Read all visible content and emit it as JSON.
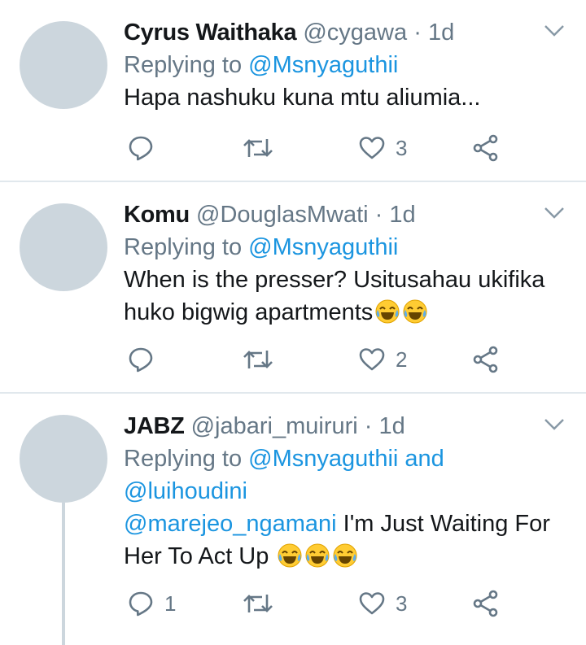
{
  "tweets": [
    {
      "name": "Cyrus Waithaka",
      "handle": "@cygawa",
      "dot": "·",
      "time": "1d",
      "replying_prefix": "Replying to",
      "replying_to": "@Msnyaguthii",
      "text": "Hapa nashuku kuna mtu aliumia...",
      "reply_count": "",
      "retweet_count": "",
      "like_count": "3"
    },
    {
      "name": "Komu",
      "handle": "@DouglasMwati",
      "dot": "·",
      "time": "1d",
      "replying_prefix": "Replying to",
      "replying_to": "@Msnyaguthii",
      "text_line1": "When is the presser? Usitusahau ukifika",
      "text_line2": "huko bigwig apartments",
      "reply_count": "",
      "retweet_count": "",
      "like_count": "2"
    },
    {
      "name": "JABZ",
      "handle": "@jabari_muiruri",
      "dot": "·",
      "time": "1d",
      "replying_prefix": "Replying to",
      "replying_to": "@Msnyaguthii",
      "replying_and": "and",
      "replying_to_2": "@luihoudini",
      "text_mention": "@marejeo_ngamani",
      "text_line1": "I'm Just Waiting For",
      "text_line2": "Her To Act Up",
      "reply_count": "1",
      "retweet_count": "",
      "like_count": "3"
    }
  ],
  "colors": {
    "link": "#1b95e0",
    "secondary": "#657786",
    "avatar": "#ccd6dd",
    "divider": "#e1e8ed"
  },
  "icons": {
    "caret": "chevron-down-icon",
    "reply": "reply-icon",
    "retweet": "retweet-icon",
    "like": "heart-icon",
    "share": "share-icon",
    "emoji": "face-with-tears-of-joy-emoji"
  }
}
